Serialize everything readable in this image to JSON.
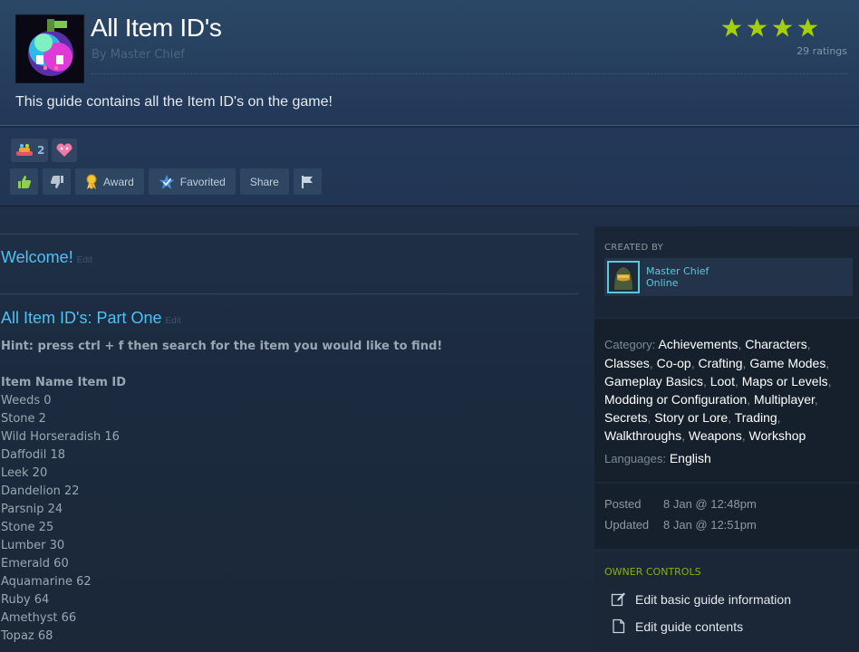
{
  "header": {
    "title": "All Item ID's",
    "author_prefix": "By",
    "author_name": "Master Chief",
    "rating_count": "29 ratings",
    "stars": 4,
    "description": "This guide contains all the Item ID's on the game!"
  },
  "reactions": [
    {
      "icon": "party-reaction-icon",
      "count": "2"
    },
    {
      "icon": "heart-reaction-icon",
      "count": ""
    }
  ],
  "actions": {
    "thumbs_up_icon": "thumbs-up-icon",
    "thumbs_down_icon": "thumbs-down-icon",
    "award_label": "Award",
    "favorited_label": "Favorited",
    "share_label": "Share",
    "flag_icon": "flag-icon"
  },
  "sections": [
    {
      "title": "Welcome!",
      "edit": "Edit"
    },
    {
      "title": "All Item ID's: Part One",
      "edit": "Edit"
    }
  ],
  "hint": "Hint: press ctrl + f then search for the item you would like to find!",
  "items_header": "Item Name Item ID",
  "items": [
    "Weeds 0",
    "Stone 2",
    "Wild Horseradish 16",
    "Daffodil 18",
    "Leek 20",
    "Dandelion 22",
    "Parsnip 24",
    "Stone 25",
    "Lumber 30",
    "Emerald 60",
    "Aquamarine 62",
    "Ruby 64",
    "Amethyst 66",
    "Topaz 68"
  ],
  "sidebar": {
    "created_by_label": "CREATED BY",
    "creator_name": "Master Chief",
    "creator_status": "Online",
    "category_label": "Category:",
    "categories": [
      "Achievements",
      "Characters",
      "Classes",
      "Co-op",
      "Crafting",
      "Game Modes",
      "Gameplay Basics",
      "Loot",
      "Maps or Levels",
      "Modding or Configuration",
      "Multiplayer",
      "Secrets",
      "Story or Lore",
      "Trading",
      "Walkthroughs",
      "Weapons",
      "Workshop"
    ],
    "languages_label": "Languages:",
    "language": "English",
    "posted_label": "Posted",
    "posted_value": "8 Jan @ 12:48pm",
    "updated_label": "Updated",
    "updated_value": "8 Jan @ 12:51pm",
    "owner_controls_label": "OWNER CONTROLS",
    "edit_info_label": "Edit basic guide information",
    "edit_contents_label": "Edit guide contents"
  },
  "colors": {
    "accent_blue": "#4fc1f2",
    "star_green": "#a4d007",
    "online_teal": "#57cbde"
  }
}
